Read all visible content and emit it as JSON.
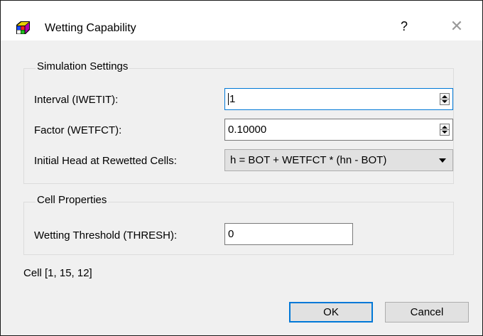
{
  "window": {
    "title": "Wetting Capability",
    "help_label": "?",
    "close_label": "✕",
    "icon": "grid-cube-icon"
  },
  "simulation_settings": {
    "title": "Simulation Settings",
    "interval_label": "Interval (IWETIT):",
    "interval_value": "1",
    "factor_label": "Factor (WETFCT):",
    "factor_value": "0.10000",
    "initial_head_label": "Initial Head at Rewetted Cells:",
    "initial_head_selected": "h = BOT + WETFCT * (hn - BOT)"
  },
  "cell_properties": {
    "title": "Cell Properties",
    "threshold_label": "Wetting Threshold (THRESH):",
    "threshold_value": "0"
  },
  "status": {
    "cell_text": "Cell [1, 15, 12]"
  },
  "buttons": {
    "ok_label": "OK",
    "cancel_label": "Cancel"
  }
}
